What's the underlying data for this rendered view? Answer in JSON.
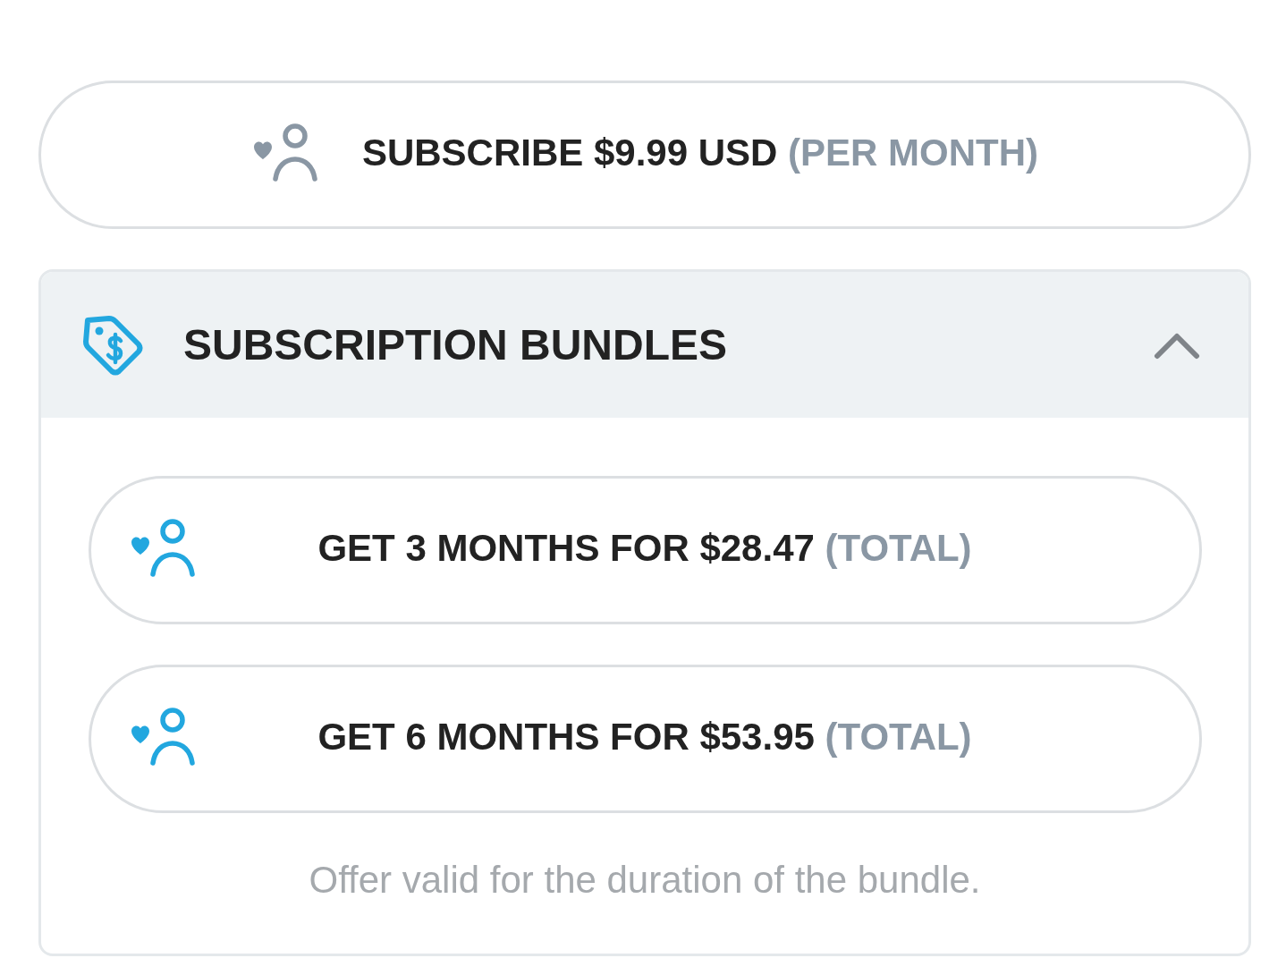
{
  "subscribe_button": {
    "label": "SUBSCRIBE $9.99 USD",
    "note": "(PER MONTH)"
  },
  "bundles": {
    "title": "SUBSCRIPTION BUNDLES",
    "expanded": true,
    "items": [
      {
        "label": "GET 3 MONTHS FOR $28.47",
        "note": "(TOTAL)"
      },
      {
        "label": "GET 6 MONTHS FOR $53.95",
        "note": "(TOTAL)"
      }
    ],
    "footnote": "Offer valid for the duration of the bundle."
  }
}
